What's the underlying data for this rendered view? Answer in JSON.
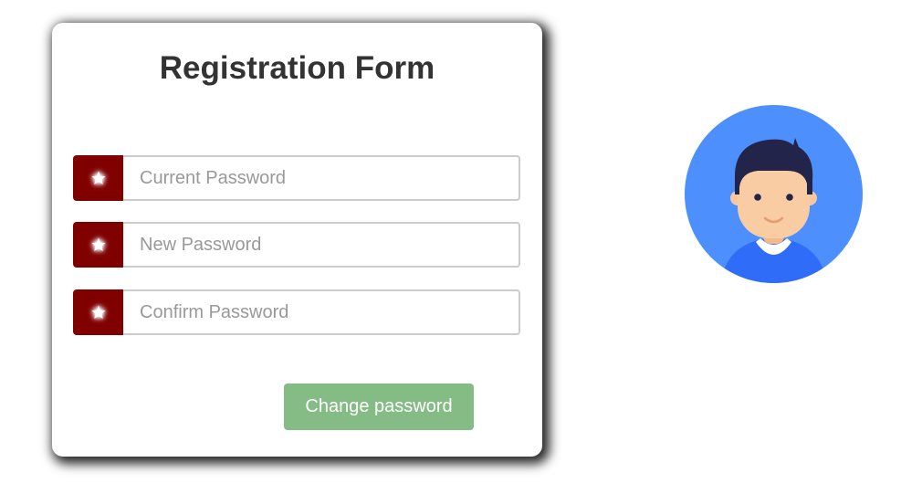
{
  "form": {
    "title": "Registration Form",
    "fields": [
      {
        "placeholder": "Current Password",
        "value": "",
        "icon": "star-icon"
      },
      {
        "placeholder": "New Password",
        "value": "",
        "icon": "star-icon"
      },
      {
        "placeholder": "Confirm Password",
        "value": "",
        "icon": "star-icon"
      }
    ],
    "submit_label": "Change password"
  },
  "avatar": {
    "icon": "user-avatar-icon"
  },
  "colors": {
    "addon_bg": "#800000",
    "button_bg": "#85bc85",
    "avatar_bg": "#4d8ffd",
    "title": "#333333"
  }
}
